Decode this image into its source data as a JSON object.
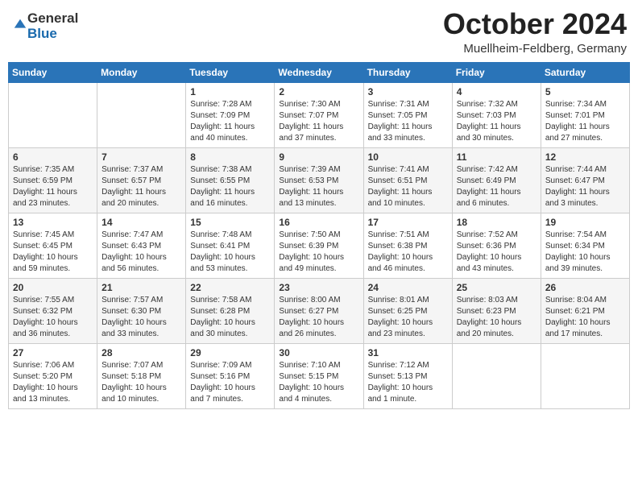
{
  "header": {
    "logo_general": "General",
    "logo_blue": "Blue",
    "month_title": "October 2024",
    "location": "Muellheim-Feldberg, Germany"
  },
  "days_of_week": [
    "Sunday",
    "Monday",
    "Tuesday",
    "Wednesday",
    "Thursday",
    "Friday",
    "Saturday"
  ],
  "weeks": [
    [
      {
        "day": "",
        "info": ""
      },
      {
        "day": "",
        "info": ""
      },
      {
        "day": "1",
        "info": "Sunrise: 7:28 AM\nSunset: 7:09 PM\nDaylight: 11 hours and 40 minutes."
      },
      {
        "day": "2",
        "info": "Sunrise: 7:30 AM\nSunset: 7:07 PM\nDaylight: 11 hours and 37 minutes."
      },
      {
        "day": "3",
        "info": "Sunrise: 7:31 AM\nSunset: 7:05 PM\nDaylight: 11 hours and 33 minutes."
      },
      {
        "day": "4",
        "info": "Sunrise: 7:32 AM\nSunset: 7:03 PM\nDaylight: 11 hours and 30 minutes."
      },
      {
        "day": "5",
        "info": "Sunrise: 7:34 AM\nSunset: 7:01 PM\nDaylight: 11 hours and 27 minutes."
      }
    ],
    [
      {
        "day": "6",
        "info": "Sunrise: 7:35 AM\nSunset: 6:59 PM\nDaylight: 11 hours and 23 minutes."
      },
      {
        "day": "7",
        "info": "Sunrise: 7:37 AM\nSunset: 6:57 PM\nDaylight: 11 hours and 20 minutes."
      },
      {
        "day": "8",
        "info": "Sunrise: 7:38 AM\nSunset: 6:55 PM\nDaylight: 11 hours and 16 minutes."
      },
      {
        "day": "9",
        "info": "Sunrise: 7:39 AM\nSunset: 6:53 PM\nDaylight: 11 hours and 13 minutes."
      },
      {
        "day": "10",
        "info": "Sunrise: 7:41 AM\nSunset: 6:51 PM\nDaylight: 11 hours and 10 minutes."
      },
      {
        "day": "11",
        "info": "Sunrise: 7:42 AM\nSunset: 6:49 PM\nDaylight: 11 hours and 6 minutes."
      },
      {
        "day": "12",
        "info": "Sunrise: 7:44 AM\nSunset: 6:47 PM\nDaylight: 11 hours and 3 minutes."
      }
    ],
    [
      {
        "day": "13",
        "info": "Sunrise: 7:45 AM\nSunset: 6:45 PM\nDaylight: 10 hours and 59 minutes."
      },
      {
        "day": "14",
        "info": "Sunrise: 7:47 AM\nSunset: 6:43 PM\nDaylight: 10 hours and 56 minutes."
      },
      {
        "day": "15",
        "info": "Sunrise: 7:48 AM\nSunset: 6:41 PM\nDaylight: 10 hours and 53 minutes."
      },
      {
        "day": "16",
        "info": "Sunrise: 7:50 AM\nSunset: 6:39 PM\nDaylight: 10 hours and 49 minutes."
      },
      {
        "day": "17",
        "info": "Sunrise: 7:51 AM\nSunset: 6:38 PM\nDaylight: 10 hours and 46 minutes."
      },
      {
        "day": "18",
        "info": "Sunrise: 7:52 AM\nSunset: 6:36 PM\nDaylight: 10 hours and 43 minutes."
      },
      {
        "day": "19",
        "info": "Sunrise: 7:54 AM\nSunset: 6:34 PM\nDaylight: 10 hours and 39 minutes."
      }
    ],
    [
      {
        "day": "20",
        "info": "Sunrise: 7:55 AM\nSunset: 6:32 PM\nDaylight: 10 hours and 36 minutes."
      },
      {
        "day": "21",
        "info": "Sunrise: 7:57 AM\nSunset: 6:30 PM\nDaylight: 10 hours and 33 minutes."
      },
      {
        "day": "22",
        "info": "Sunrise: 7:58 AM\nSunset: 6:28 PM\nDaylight: 10 hours and 30 minutes."
      },
      {
        "day": "23",
        "info": "Sunrise: 8:00 AM\nSunset: 6:27 PM\nDaylight: 10 hours and 26 minutes."
      },
      {
        "day": "24",
        "info": "Sunrise: 8:01 AM\nSunset: 6:25 PM\nDaylight: 10 hours and 23 minutes."
      },
      {
        "day": "25",
        "info": "Sunrise: 8:03 AM\nSunset: 6:23 PM\nDaylight: 10 hours and 20 minutes."
      },
      {
        "day": "26",
        "info": "Sunrise: 8:04 AM\nSunset: 6:21 PM\nDaylight: 10 hours and 17 minutes."
      }
    ],
    [
      {
        "day": "27",
        "info": "Sunrise: 7:06 AM\nSunset: 5:20 PM\nDaylight: 10 hours and 13 minutes."
      },
      {
        "day": "28",
        "info": "Sunrise: 7:07 AM\nSunset: 5:18 PM\nDaylight: 10 hours and 10 minutes."
      },
      {
        "day": "29",
        "info": "Sunrise: 7:09 AM\nSunset: 5:16 PM\nDaylight: 10 hours and 7 minutes."
      },
      {
        "day": "30",
        "info": "Sunrise: 7:10 AM\nSunset: 5:15 PM\nDaylight: 10 hours and 4 minutes."
      },
      {
        "day": "31",
        "info": "Sunrise: 7:12 AM\nSunset: 5:13 PM\nDaylight: 10 hours and 1 minute."
      },
      {
        "day": "",
        "info": ""
      },
      {
        "day": "",
        "info": ""
      }
    ]
  ]
}
